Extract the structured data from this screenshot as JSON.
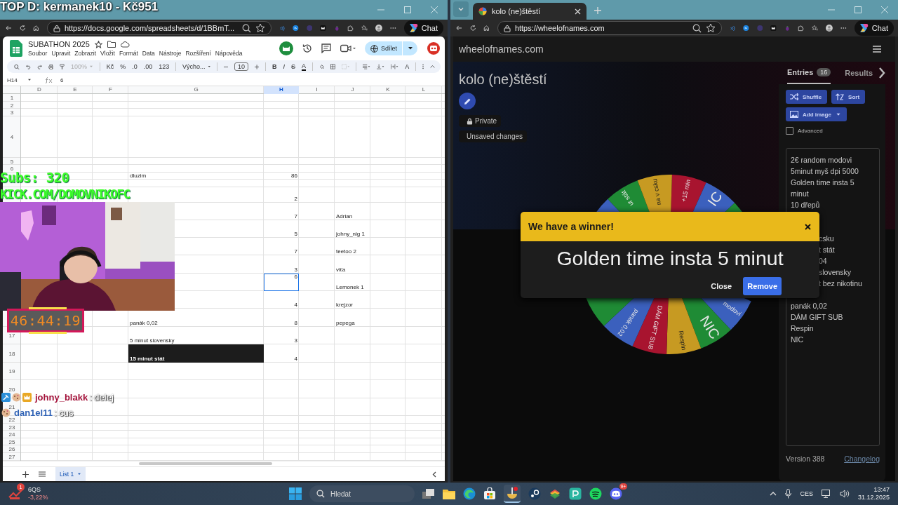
{
  "overlay": {
    "top_donor": "TOP D: kermanek10 - Kč951",
    "subs": "Subs: 320",
    "channel": "KICK.COM/DOMOVNIKOFC",
    "timer": "46:44:19",
    "chat": [
      {
        "user": "johny_blakk",
        "color": "#a3123a",
        "message": ": delej"
      },
      {
        "user": "dan1el11",
        "color": "#2f62b5",
        "message": ": cus"
      }
    ]
  },
  "browsers": [
    {
      "url": "https://docs.google.com/spreadsheets/d/1BBmT...",
      "chat_button": "Chat"
    },
    {
      "tab": {
        "title": "kolo (ne)štěstí"
      },
      "url": "https://wheelofnames.com",
      "chat_button": "Chat"
    }
  ],
  "sheet": {
    "title": "SUBATHON 2025",
    "menu": [
      "Soubor",
      "Upravit",
      "Zobrazit",
      "Vložit",
      "Formát",
      "Data",
      "Nástroje",
      "Rozšíření",
      "Nápověda"
    ],
    "share": "Sdílet",
    "toolbar": {
      "zoom": "100%",
      "currency": "Kč",
      "percent": "%",
      "dec_less": ".0",
      "dec_more": ".00",
      "number_format": "123",
      "font": "Výcho...",
      "font_size": "10",
      "bold": "B",
      "italic": "I",
      "strike": "S",
      "text_color": "A",
      "rotate": "A"
    },
    "name_box": "H14",
    "formula": "6",
    "columns": [
      {
        "label": "D",
        "selected": false
      },
      {
        "label": "E",
        "selected": false
      },
      {
        "label": "F",
        "selected": false
      },
      {
        "label": "G",
        "selected": false
      },
      {
        "label": "H",
        "selected": true
      },
      {
        "label": "I",
        "selected": false
      },
      {
        "label": "J",
        "selected": false
      },
      {
        "label": "K",
        "selected": false
      },
      {
        "label": "L",
        "selected": false
      }
    ],
    "rows": [
      {
        "num": "1"
      },
      {
        "num": "2"
      },
      {
        "num": "3"
      },
      {
        "num": "4"
      },
      {
        "num": "5"
      },
      {
        "num": "6"
      },
      {
        "g": {
          "text": "dluzim",
          "kind": "text",
          "selected": false,
          "dark": false
        },
        "h": {
          "text": "86",
          "kind": "number",
          "selected": false,
          "dark": false
        }
      },
      {},
      {
        "h": {
          "text": "2",
          "kind": "number",
          "selected": false,
          "dark": false
        }
      },
      {
        "h": {
          "text": "7",
          "kind": "number",
          "selected": false,
          "dark": false
        },
        "j": {
          "text": "Adrian",
          "kind": "text",
          "selected": false,
          "dark": false
        }
      },
      {
        "h": {
          "text": "5",
          "kind": "number",
          "selected": false,
          "dark": false
        },
        "j": {
          "text": "johny_nig 1",
          "kind": "text",
          "selected": false,
          "dark": false
        }
      },
      {
        "h": {
          "text": "7",
          "kind": "number",
          "selected": false,
          "dark": false
        },
        "j": {
          "text": "teetoo 2",
          "kind": "text",
          "selected": false,
          "dark": false
        }
      },
      {
        "h": {
          "text": "3",
          "kind": "number",
          "selected": false,
          "dark": false
        },
        "j": {
          "text": "viťa",
          "kind": "text",
          "selected": false,
          "dark": false
        }
      },
      {
        "h": {
          "text": "6",
          "kind": "number",
          "selected": true,
          "dark": false
        },
        "j": {
          "text": "Lemonek 1",
          "kind": "text",
          "selected": false,
          "dark": false
        }
      },
      {
        "h": {
          "text": "4",
          "kind": "number",
          "selected": false,
          "dark": false
        },
        "j": {
          "text": "krejzor",
          "kind": "text",
          "selected": false,
          "dark": false
        }
      },
      {
        "g": {
          "text": "panák 0,02",
          "kind": "text",
          "selected": false,
          "dark": false
        },
        "h": {
          "text": "8",
          "kind": "number",
          "selected": false,
          "dark": false
        },
        "j": {
          "text": "pepega",
          "kind": "text",
          "selected": false,
          "dark": false
        }
      },
      {
        "num": "17",
        "g": {
          "text": "5 minut slovensky",
          "kind": "text",
          "selected": false,
          "dark": false
        },
        "h": {
          "text": "3",
          "kind": "number",
          "selected": false,
          "dark": false
        }
      },
      {
        "num": "18",
        "g": {
          "text": "15 minut stát",
          "kind": "text",
          "selected": false,
          "dark": true
        },
        "h": {
          "text": "4",
          "kind": "number",
          "selected": false,
          "dark": false
        }
      },
      {
        "num": "19"
      },
      {
        "num": "20"
      },
      {
        "num": "21"
      },
      {
        "num": "22"
      },
      {
        "num": "23"
      },
      {
        "num": "24"
      },
      {
        "num": "25"
      },
      {
        "num": "26"
      },
      {
        "num": "27"
      }
    ],
    "sheet_tabs": [
      {
        "label": "List 1",
        "selected": true
      }
    ]
  },
  "wheel_page": {
    "site": "wheelofnames.com",
    "title": "kolo (ne)štěstí",
    "privacy": "Private",
    "status": "Unsaved changes",
    "tabs": [
      {
        "label": "Entries",
        "count": "16",
        "selected": true
      },
      {
        "label": "Results",
        "selected": false
      }
    ],
    "buttons": {
      "shuffle": "Shuffle",
      "sort": "Sort",
      "add_image": "Add image"
    },
    "advanced": {
      "label": "Advanced",
      "checked": false
    },
    "entries": [
      {
        "kind": "full",
        "text": "2€ random modovi"
      },
      {
        "kind": "full",
        "text": "5minut myš dpi 5000"
      },
      {
        "kind": "full",
        "text": "Golden time insta 5 minut"
      },
      {
        "kind": "full",
        "text": "10 dřepů"
      },
      {
        "kind": "covered"
      },
      {
        "kind": "covered"
      },
      {
        "kind": "cut",
        "text": "csku"
      },
      {
        "kind": "cut",
        "text": "t stát"
      },
      {
        "kind": "cut",
        "text": "04"
      },
      {
        "kind": "cut",
        "text": "slovensky"
      },
      {
        "kind": "cut",
        "text": "t bez nikotinu"
      },
      {
        "kind": "covered"
      },
      {
        "kind": "full",
        "text": "panák 0,02"
      },
      {
        "kind": "full",
        "text": "DÁM GIFT SUB"
      },
      {
        "kind": "full",
        "text": "Respin"
      },
      {
        "kind": "full",
        "text": "NIC"
      }
    ],
    "version": "Version 388",
    "changelog": "Changelog",
    "wheel": {
      "segments": [
        {
          "kind": "shown",
          "color": "#a8142f",
          "label": "+15 min"
        },
        {
          "kind": "shown",
          "color": "#3b60bd",
          "label": "IC"
        },
        {
          "kind": "shown",
          "color": "#1f8b35"
        },
        {
          "kind": "covered"
        },
        {
          "kind": "covered"
        },
        {
          "kind": "shown",
          "color": "#3b60bd",
          "label": "modovi"
        },
        {
          "kind": "shown",
          "color": "#1f8b35",
          "label": "NIC"
        },
        {
          "kind": "shown",
          "color": "#c79a22",
          "label": "Respin"
        },
        {
          "kind": "shown",
          "color": "#a8142f",
          "label": "DÁM GIFT SUB"
        },
        {
          "kind": "shown",
          "color": "#3b60bd",
          "label": "panák 0,02"
        },
        {
          "kind": "shown",
          "color": "#1f8b35"
        },
        {
          "kind": "covered"
        },
        {
          "kind": "covered"
        },
        {
          "kind": "shown",
          "color": "#3b60bd"
        },
        {
          "kind": "shown",
          "color": "#1f8b35",
          "label": "ut stát"
        },
        {
          "kind": "shown",
          "color": "#c79a22",
          "label": "na v csku"
        }
      ]
    },
    "winner": {
      "heading": "We have a winner!",
      "name": "Golden time insta 5 minut",
      "close": "Close",
      "remove": "Remove"
    }
  },
  "taskbar": {
    "stock": {
      "symbol": "6QS",
      "change": "-3,22%",
      "badge": "1"
    },
    "search": "Hledat",
    "discord_badge": "9+",
    "language": "CES",
    "time": "13:47",
    "date": "31.12.2025"
  }
}
